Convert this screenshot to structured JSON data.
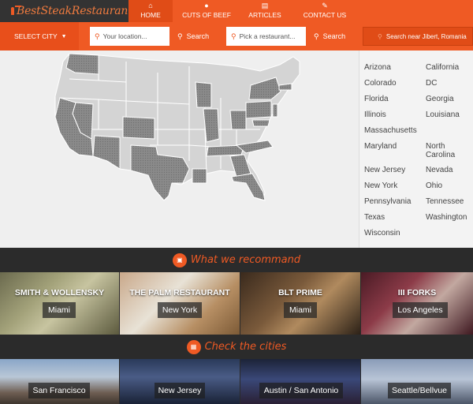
{
  "logo": {
    "text": "BestSteakRestaurant"
  },
  "nav": {
    "home": {
      "icon": "home-icon",
      "label": "HOME"
    },
    "cuts": {
      "icon": "steak-icon",
      "label": "CUTS OF BEEF"
    },
    "articles": {
      "icon": "article-icon",
      "label": "ARTICLES"
    },
    "contact": {
      "icon": "pencil-icon",
      "label": "CONTACT US"
    }
  },
  "search": {
    "select_city": "SELECT CITY",
    "location_placeholder": "Your location...",
    "restaurant_placeholder": "Pick a restaurant...",
    "search_label": "Search",
    "near_label": "Search near Jibert, Romania"
  },
  "states": [
    "Arizona",
    "California",
    "Colorado",
    "DC",
    "Florida",
    "Georgia",
    "Illinois",
    "Louisiana",
    "Massachusetts",
    "Maryland",
    "North Carolina",
    "New Jersey",
    "Nevada",
    "New York",
    "Ohio",
    "Pennsylvania",
    "Tennessee",
    "Texas",
    "Washington",
    "Wisconsin"
  ],
  "recommend": {
    "icon": "map-icon",
    "title": "What we recommand"
  },
  "restaurants": [
    {
      "name": "SMITH & WOLLENSKY",
      "city": "Miami"
    },
    {
      "name": "THE PALM RESTAURANT",
      "city": "New York"
    },
    {
      "name": "BLT PRIME",
      "city": "Miami"
    },
    {
      "name": "III FORKS",
      "city": "Los Angeles"
    }
  ],
  "cities_section": {
    "icon": "building-icon",
    "title": "Check the cities"
  },
  "cities": [
    "San Francisco",
    "New Jersey",
    "Austin / San Antonio",
    "Seattle/Bellvue"
  ],
  "colors": {
    "accent": "#ef5a24",
    "dark": "#2b2b2b"
  }
}
